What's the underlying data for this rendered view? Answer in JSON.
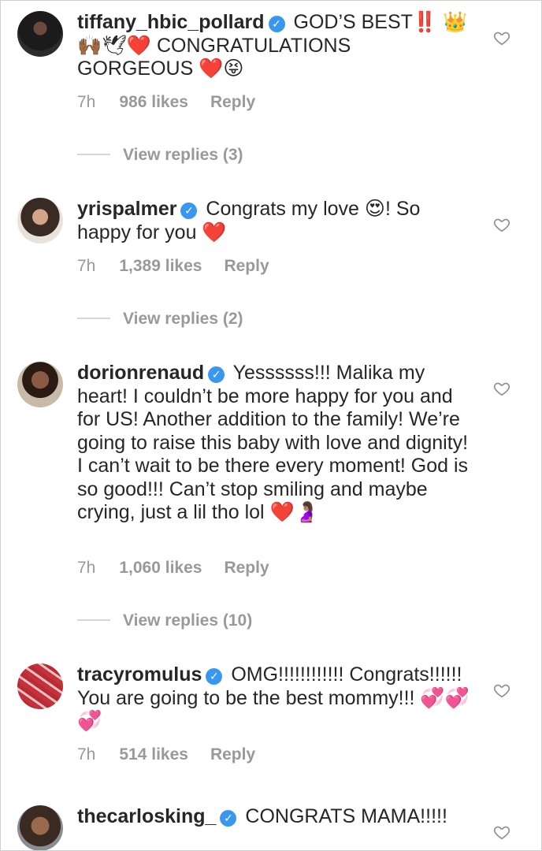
{
  "comments": [
    {
      "username": "tiffany_hbic_pollard",
      "text": "GOD’S BEST‼️ 👑🙌🏾🕊❤️ CONGRATULATIONS GORGEOUS ❤️😝",
      "time": "7h",
      "likes": "986 likes",
      "reply": "Reply",
      "view_replies": "View replies (3)"
    },
    {
      "username": "yrispalmer",
      "text": "Congrats my love 😍! So happy for you ❤️",
      "time": "7h",
      "likes": "1,389 likes",
      "reply": "Reply",
      "view_replies": "View replies (2)"
    },
    {
      "username": "dorionrenaud",
      "text": "Yessssss!!! Malika my heart! I couldn’t be more happy for you and for US! Another addition to the family! We’re going to raise this baby with love and dignity! I can’t wait to be there every moment! God is so good!!! Can’t stop smiling and maybe crying, just a lil tho lol ❤️🤰🏽",
      "time": "7h",
      "likes": "1,060 likes",
      "reply": "Reply",
      "view_replies": "View replies (10)"
    },
    {
      "username": "tracyromulus",
      "text": "OMG!!!!!!!!!!!! Congrats!!!!!! You are going to be the best mommy!!! 💞💞💞",
      "time": "7h",
      "likes": "514 likes",
      "reply": "Reply"
    },
    {
      "username": "thecarlosking_",
      "text": "CONGRATS MAMA!!!!!"
    }
  ],
  "icons": {
    "verified": "verified-badge-icon",
    "like": "heart-outline-icon"
  },
  "colors": {
    "verified": "#3897f0",
    "meta": "#999999",
    "text": "#262626"
  }
}
